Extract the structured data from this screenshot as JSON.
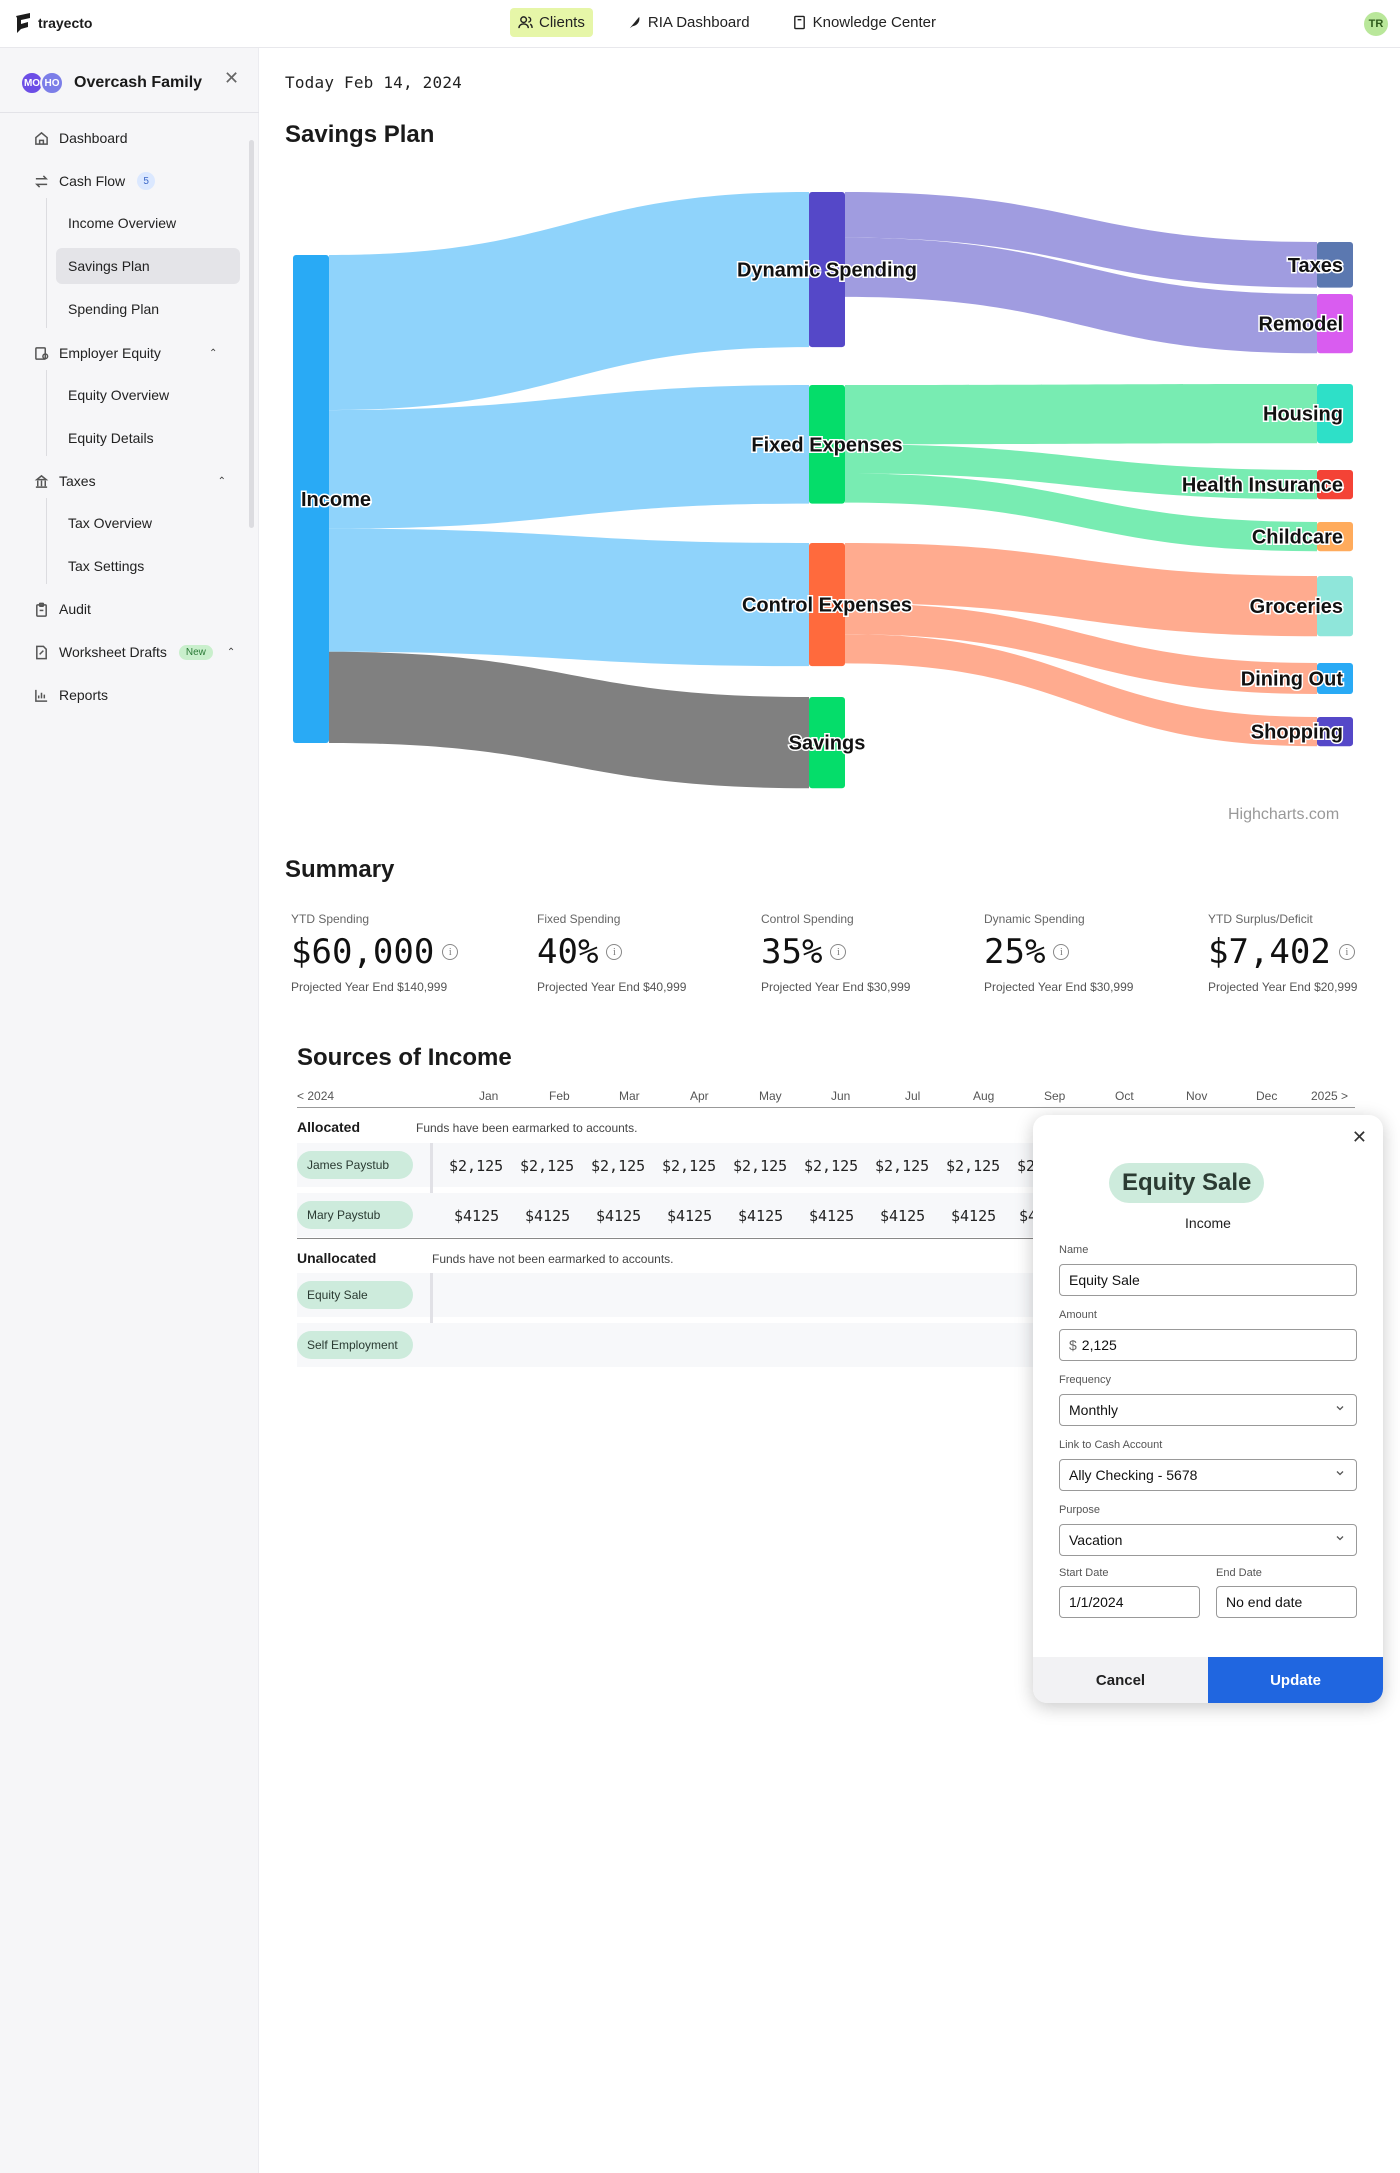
{
  "app": {
    "logo_text": "trayecto",
    "user_initials": "TR"
  },
  "topnav": [
    {
      "label": "Clients",
      "icon": "users-icon",
      "active": true
    },
    {
      "label": "RIA Dashboard",
      "icon": "feather-icon",
      "active": false
    },
    {
      "label": "Knowledge Center",
      "icon": "book-icon",
      "active": false
    }
  ],
  "sidebar": {
    "family": {
      "name": "Overcash Family",
      "avatars": [
        "MO",
        "HO"
      ]
    },
    "items": [
      {
        "label": "Dashboard",
        "icon": "home-icon"
      },
      {
        "label": "Cash Flow",
        "icon": "swap-icon",
        "badge": "5"
      },
      {
        "label": "Income Overview"
      },
      {
        "label": "Savings Plan",
        "active": true
      },
      {
        "label": "Spending Plan"
      },
      {
        "label": "Employer Equity",
        "icon": "briefcase-icon"
      },
      {
        "label": "Equity Overview"
      },
      {
        "label": "Equity Details"
      },
      {
        "label": "Taxes",
        "icon": "building-icon"
      },
      {
        "label": "Tax Overview"
      },
      {
        "label": "Tax Settings"
      },
      {
        "label": "Audit",
        "icon": "clipboard-icon"
      },
      {
        "label": "Worksheet Drafts",
        "icon": "document-icon",
        "badge": "New"
      },
      {
        "label": "Reports",
        "icon": "chart-icon"
      }
    ]
  },
  "main": {
    "today": "Today Feb 14, 2024",
    "savings_title": "Savings Plan",
    "credit": "Highcharts.com",
    "summary_title": "Summary",
    "stats": [
      {
        "label": "YTD Spending",
        "value": "$60,000",
        "sub": "Projected Year End $140,999"
      },
      {
        "label": "Fixed Spending",
        "value": "40%",
        "sub": "Projected Year End $40,999"
      },
      {
        "label": "Control Spending",
        "value": "35%",
        "sub": "Projected Year End $30,999"
      },
      {
        "label": "Dynamic Spending",
        "value": "25%",
        "sub": "Projected Year End $30,999"
      },
      {
        "label": "YTD Surplus/Deficit",
        "value": "$7,402",
        "sub": "Projected Year End $20,999"
      }
    ],
    "sources_title": "Sources of Income",
    "year_prev": "<  2024",
    "year_next": "2025 >",
    "months": [
      "Jan",
      "Feb",
      "Mar",
      "Apr",
      "May",
      "Jun",
      "Jul",
      "Aug",
      "Sep",
      "Oct",
      "Nov",
      "Dec"
    ],
    "allocated": {
      "label": "Allocated",
      "note": "Funds have been earmarked to accounts."
    },
    "unallocated": {
      "label": "Unallocated",
      "note": "Funds have not been earmarked to accounts."
    },
    "rows": [
      {
        "name": "James Paystub",
        "values": [
          "$2,125",
          "$2,125",
          "$2,125",
          "$2,125",
          "$2,125",
          "$2,125",
          "$2,125",
          "$2,125",
          "$2"
        ]
      },
      {
        "name": "Mary Paystub",
        "values": [
          "$4125",
          "$4125",
          "$4125",
          "$4125",
          "$4125",
          "$4125",
          "$4125",
          "$4125",
          "$4"
        ]
      },
      {
        "name": "Equity Sale",
        "values": []
      },
      {
        "name": "Self Employment",
        "values": []
      }
    ]
  },
  "chart_data": {
    "type": "sankey",
    "nodes": [
      {
        "id": "Income",
        "color": "#29aaf5"
      },
      {
        "id": "Dynamic Spending",
        "color": "#5548c8"
      },
      {
        "id": "Fixed Expenses",
        "color": "#05dd6a"
      },
      {
        "id": "Control Expenses",
        "color": "#ff6a3d"
      },
      {
        "id": "Savings",
        "color": "#05dd6a"
      },
      {
        "id": "Taxes",
        "color": "#5b78b0"
      },
      {
        "id": "Remodel",
        "color": "#d95cf0"
      },
      {
        "id": "Housing",
        "color": "#2ee0c8"
      },
      {
        "id": "Health Insurance",
        "color": "#f44336"
      },
      {
        "id": "Childcare",
        "color": "#ffab5c"
      },
      {
        "id": "Groceries",
        "color": "#8fe6da"
      },
      {
        "id": "Dining Out",
        "color": "#29aaf5"
      },
      {
        "id": "Shopping",
        "color": "#5548c8"
      }
    ],
    "links": [
      {
        "from": "Income",
        "to": "Dynamic Spending",
        "weight": 17
      },
      {
        "from": "Income",
        "to": "Fixed Expenses",
        "weight": 13
      },
      {
        "from": "Income",
        "to": "Control Expenses",
        "weight": 13.5
      },
      {
        "from": "Income",
        "to": "Savings",
        "weight": 10
      },
      {
        "from": "Dynamic Spending",
        "to": "Taxes",
        "weight": 5
      },
      {
        "from": "Dynamic Spending",
        "to": "Remodel",
        "weight": 6.5
      },
      {
        "from": "Fixed Expenses",
        "to": "Housing",
        "weight": 6.5
      },
      {
        "from": "Fixed Expenses",
        "to": "Health Insurance",
        "weight": 3.2
      },
      {
        "from": "Fixed Expenses",
        "to": "Childcare",
        "weight": 3.2
      },
      {
        "from": "Control Expenses",
        "to": "Groceries",
        "weight": 6.6
      },
      {
        "from": "Control Expenses",
        "to": "Dining Out",
        "weight": 3.4
      },
      {
        "from": "Control Expenses",
        "to": "Shopping",
        "weight": 3.2
      }
    ]
  },
  "modal": {
    "title": "Equity Sale",
    "subtitle": "Income",
    "fields": {
      "name_label": "Name",
      "name_value": "Equity Sale",
      "amount_label": "Amount",
      "amount_prefix": "$",
      "amount_value": "2,125",
      "frequency_label": "Frequency",
      "frequency_value": "Monthly",
      "account_label": "Link to Cash Account",
      "account_value": "Ally Checking - 5678",
      "purpose_label": "Purpose",
      "purpose_value": "Vacation",
      "start_label": "Start Date",
      "start_value": "1/1/2024",
      "end_label": "End Date",
      "end_value": "No end date"
    },
    "cancel": "Cancel",
    "update": "Update"
  }
}
